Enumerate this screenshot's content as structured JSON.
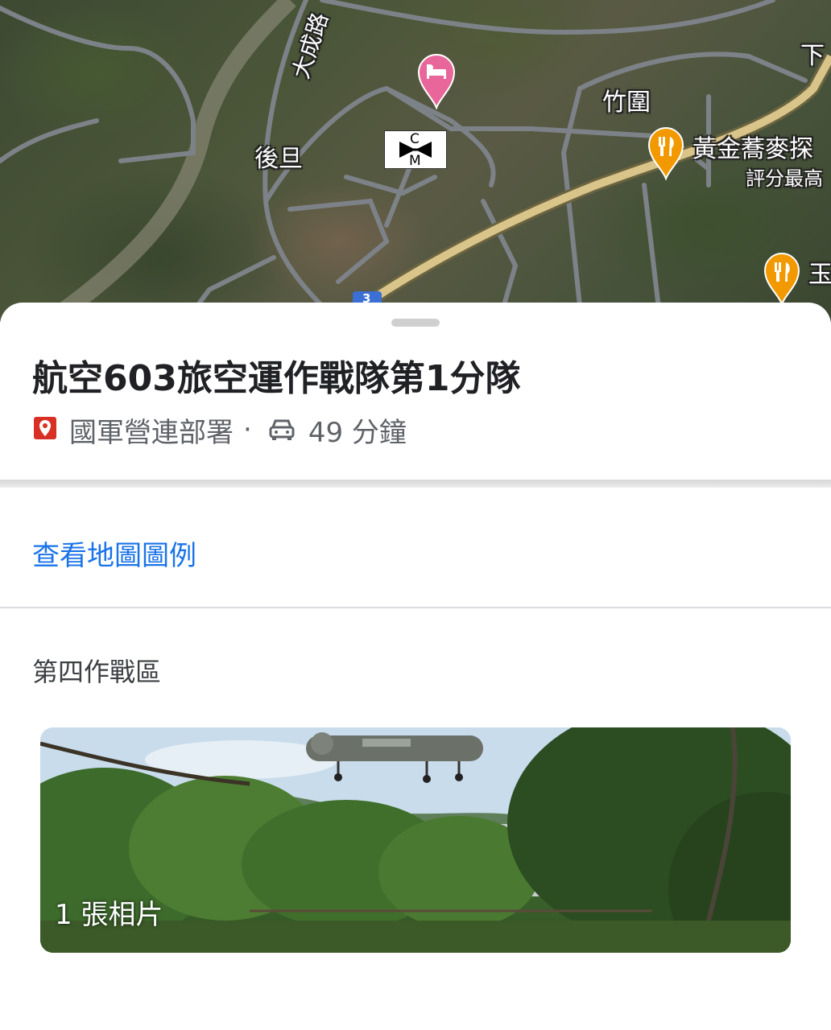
{
  "map": {
    "labels": {
      "road_dacheng": "大成路",
      "village_houdan": "後旦",
      "village_zhuwei": "竹圍",
      "restaurant_name": "黃金蕎麥探",
      "restaurant_rating": "評分最高",
      "partial_top_right": "下",
      "partial_restaurant2": "玉",
      "route_shield": "3",
      "cm_top": "C",
      "cm_bottom": "M"
    },
    "colors": {
      "hotel_pin": "#e8669a",
      "restaurant_pin": "#f29900",
      "highway": "#d9c48a",
      "road": "#7a7f84",
      "route_shield": "#3b6fd4"
    }
  },
  "place": {
    "title": "航空603旅空運作戰隊第1分隊",
    "category": "國軍營連部署",
    "separator": "·",
    "drive_time": "49 分鐘",
    "icons": [
      "location-icon",
      "car-icon"
    ]
  },
  "links": {
    "map_legend": "查看地圖圖例"
  },
  "section": {
    "title": "第四作戰區"
  },
  "photos": {
    "count_label": "1 張相片"
  }
}
